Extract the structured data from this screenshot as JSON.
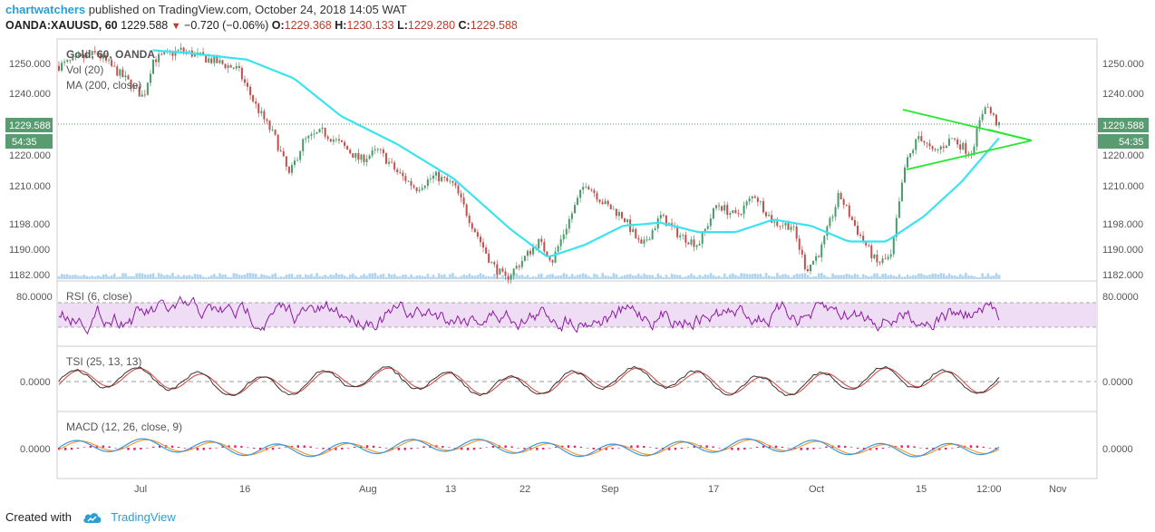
{
  "header": {
    "username": "chartwatchers",
    "published_text": "published on TradingView.com, October 24, 2018 14:05 WAT",
    "symbol": "OANDA:XAUUSD, 60",
    "last_price": "1229.588",
    "change": "−0.720 (−0.06%)",
    "o_label": "O:",
    "o_value": "1229.368",
    "h_label": "H:",
    "h_value": "1230.133",
    "l_label": "L:",
    "l_value": "1229.280",
    "c_label": "C:",
    "c_value": "1229.588"
  },
  "price_pane": {
    "legend": [
      "Gold, 60, OANDA",
      "Vol (20)",
      "MA (200, close)"
    ],
    "y_ticks": [
      "1250.000",
      "1240.000",
      "1220.000",
      "1210.000",
      "1198.000",
      "1190.000",
      "1182.000"
    ],
    "price_badge": "1229.588",
    "countdown_badge": "54:35"
  },
  "rsi_pane": {
    "legend": "RSI (6, close)",
    "tick": "80.0000"
  },
  "tsi_pane": {
    "legend": "TSI (25, 13, 13)",
    "tick": "0.0000"
  },
  "macd_pane": {
    "legend": "MACD (12, 26, close, 9)",
    "tick": "0.0000"
  },
  "x_axis": {
    "labels": [
      "Jul",
      "16",
      "Aug",
      "13",
      "22",
      "Sep",
      "17",
      "Oct",
      "15",
      "12:00",
      "Nov"
    ]
  },
  "footer": {
    "created_with": "Created with",
    "brand": "TradingView"
  },
  "colors": {
    "up": "#4a9a6a",
    "down": "#c0504d",
    "ma": "#39e3f0",
    "triangle": "#27e830",
    "rsi": "#8a1aa0",
    "rsi_band": "#efdcf5",
    "volume": "#9cc9e8",
    "badge": "#5a9c72",
    "macd_hist": "#e0246a",
    "macd_line": "#3f96d6",
    "signal_line": "#f09a3c",
    "tsi_line": "#333333",
    "tsi_signal": "#d0433a"
  },
  "chart_data": {
    "type": "candlestick",
    "y_range": [
      1181,
      1257
    ],
    "trend_triangle": "symmetrical triangle drawn on the price pane in green",
    "price_path": [
      {
        "t": 0,
        "v": 1249
      },
      {
        "t": 0.04,
        "v": 1253
      },
      {
        "t": 0.07,
        "v": 1245
      },
      {
        "t": 0.09,
        "v": 1239
      },
      {
        "t": 0.1,
        "v": 1251
      },
      {
        "t": 0.13,
        "v": 1254
      },
      {
        "t": 0.16,
        "v": 1251
      },
      {
        "t": 0.19,
        "v": 1248
      },
      {
        "t": 0.21,
        "v": 1236
      },
      {
        "t": 0.23,
        "v": 1226
      },
      {
        "t": 0.245,
        "v": 1214
      },
      {
        "t": 0.26,
        "v": 1225
      },
      {
        "t": 0.28,
        "v": 1228
      },
      {
        "t": 0.3,
        "v": 1224
      },
      {
        "t": 0.32,
        "v": 1219
      },
      {
        "t": 0.34,
        "v": 1222
      },
      {
        "t": 0.36,
        "v": 1215
      },
      {
        "t": 0.38,
        "v": 1210
      },
      {
        "t": 0.4,
        "v": 1214
      },
      {
        "t": 0.42,
        "v": 1211
      },
      {
        "t": 0.44,
        "v": 1198
      },
      {
        "t": 0.46,
        "v": 1186
      },
      {
        "t": 0.475,
        "v": 1181
      },
      {
        "t": 0.49,
        "v": 1186
      },
      {
        "t": 0.51,
        "v": 1193
      },
      {
        "t": 0.525,
        "v": 1187
      },
      {
        "t": 0.54,
        "v": 1198
      },
      {
        "t": 0.56,
        "v": 1212
      },
      {
        "t": 0.58,
        "v": 1205
      },
      {
        "t": 0.6,
        "v": 1201
      },
      {
        "t": 0.62,
        "v": 1191
      },
      {
        "t": 0.64,
        "v": 1201
      },
      {
        "t": 0.66,
        "v": 1195
      },
      {
        "t": 0.68,
        "v": 1192
      },
      {
        "t": 0.7,
        "v": 1205
      },
      {
        "t": 0.72,
        "v": 1201
      },
      {
        "t": 0.74,
        "v": 1208
      },
      {
        "t": 0.76,
        "v": 1199
      },
      {
        "t": 0.78,
        "v": 1198
      },
      {
        "t": 0.795,
        "v": 1184
      },
      {
        "t": 0.81,
        "v": 1190
      },
      {
        "t": 0.83,
        "v": 1208
      },
      {
        "t": 0.85,
        "v": 1196
      },
      {
        "t": 0.87,
        "v": 1186
      },
      {
        "t": 0.885,
        "v": 1188
      },
      {
        "t": 0.9,
        "v": 1217
      },
      {
        "t": 0.915,
        "v": 1227
      },
      {
        "t": 0.93,
        "v": 1221
      },
      {
        "t": 0.95,
        "v": 1226
      },
      {
        "t": 0.97,
        "v": 1221
      },
      {
        "t": 0.985,
        "v": 1237
      },
      {
        "t": 1,
        "v": 1229.6
      }
    ],
    "ma_path": [
      {
        "t": 0.1,
        "v": 1254
      },
      {
        "t": 0.14,
        "v": 1253
      },
      {
        "t": 0.2,
        "v": 1251
      },
      {
        "t": 0.25,
        "v": 1245
      },
      {
        "t": 0.3,
        "v": 1233
      },
      {
        "t": 0.36,
        "v": 1224
      },
      {
        "t": 0.42,
        "v": 1213
      },
      {
        "t": 0.48,
        "v": 1197
      },
      {
        "t": 0.52,
        "v": 1188
      },
      {
        "t": 0.56,
        "v": 1192
      },
      {
        "t": 0.6,
        "v": 1198
      },
      {
        "t": 0.64,
        "v": 1199
      },
      {
        "t": 0.68,
        "v": 1196
      },
      {
        "t": 0.72,
        "v": 1196
      },
      {
        "t": 0.76,
        "v": 1200
      },
      {
        "t": 0.8,
        "v": 1198
      },
      {
        "t": 0.84,
        "v": 1193
      },
      {
        "t": 0.88,
        "v": 1193
      },
      {
        "t": 0.92,
        "v": 1201
      },
      {
        "t": 0.96,
        "v": 1212
      },
      {
        "t": 1,
        "v": 1226
      }
    ]
  }
}
